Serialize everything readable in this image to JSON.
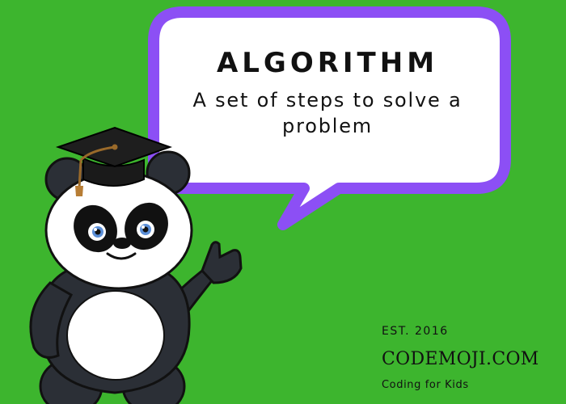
{
  "background_color": "#3db52e",
  "bubble": {
    "term": "ALGORITHM",
    "definition": "A set of steps to solve a problem",
    "border_color": "#8c4ff5",
    "fill_color": "#ffffff"
  },
  "mascot": {
    "character": "panda",
    "accessory": "graduation-cap",
    "pose": "waving"
  },
  "brand": {
    "established": "EST. 2016",
    "site": "CODEMOJI.COM",
    "tagline": "Coding for Kids"
  }
}
